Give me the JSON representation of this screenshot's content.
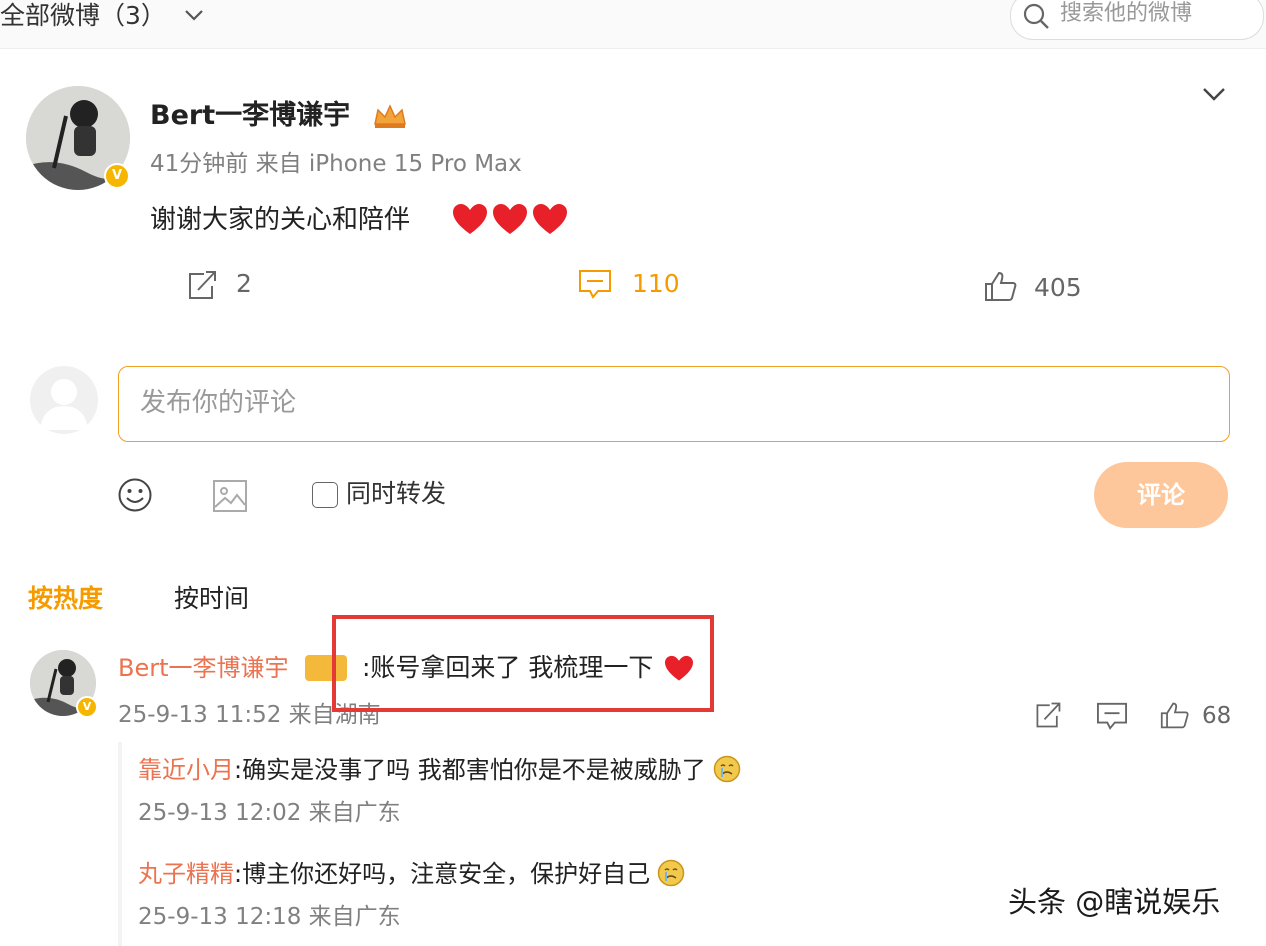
{
  "topbar": {
    "title": "全部微博（3）",
    "search_placeholder": "搜索他的微博"
  },
  "post": {
    "author": "Bert一李博谦宇",
    "meta": "41分钟前 来自 iPhone 15 Pro Max",
    "text": "谢谢大家的关心和陪伴",
    "actions": {
      "repost_count": "2",
      "comment_count": "110",
      "like_count": "405"
    }
  },
  "composer": {
    "placeholder": "发布你的评论",
    "also_repost_label": "同时转发",
    "submit_label": "评论"
  },
  "sort": {
    "hot_label": "按热度",
    "time_label": "按时间"
  },
  "comment": {
    "author": "Bert一李博谦宇",
    "text": ":账号拿回来了 我梳理一下",
    "time": "25-9-13 11:52 来自湖南",
    "like_count": "68"
  },
  "replies": [
    {
      "author": "靠近小月",
      "text": ":确实是没事了吗 我都害怕你是不是被威胁了",
      "time": "25-9-13 12:02 来自广东"
    },
    {
      "author": "丸子精精",
      "text": ":博主你还好吗，注意安全，保护好自己",
      "time": "25-9-13 12:18 来自广东"
    }
  ],
  "watermark": "头条 @瞎说娱乐",
  "colors": {
    "accent_orange": "#f59b00",
    "name_orange": "#eb7350",
    "button_disabled": "#fdc79b",
    "highlight_red": "#e53935",
    "heart_red": "#e8202a"
  },
  "icons": [
    "chevron-down-icon",
    "search-icon",
    "verified-icon",
    "crown-icon",
    "heart-icon",
    "repost-icon",
    "comment-icon",
    "like-icon",
    "emoji-icon",
    "image-icon",
    "crying-emoji-icon"
  ]
}
